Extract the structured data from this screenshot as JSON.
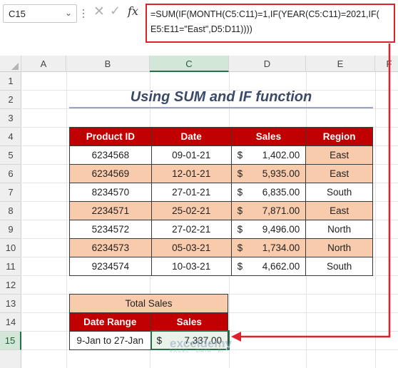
{
  "formula_bar": {
    "name_box": "C15",
    "fx_label": "fx",
    "formula_line1": "=SUM(IF(MONTH(C5:C11)=1,IF(YEAR(C5:C11)=2021,IF(",
    "formula_line2": "E5:E11=\"East\",D5:D11))))"
  },
  "columns": [
    "A",
    "B",
    "C",
    "D",
    "E",
    "F"
  ],
  "rows": [
    "1",
    "2",
    "3",
    "4",
    "5",
    "6",
    "7",
    "8",
    "9",
    "10",
    "11",
    "12",
    "13",
    "14",
    "15"
  ],
  "selected_column": "C",
  "selected_row": "15",
  "title": "Using SUM and IF function",
  "table": {
    "headers": [
      "Product ID",
      "Date",
      "Sales",
      "Region"
    ],
    "rows": [
      {
        "pid": "6234568",
        "date": "09-01-21",
        "cur": "$",
        "amount": "1,402.00",
        "region": "East"
      },
      {
        "pid": "6234569",
        "date": "12-01-21",
        "cur": "$",
        "amount": "5,935.00",
        "region": "East"
      },
      {
        "pid": "8234570",
        "date": "27-01-21",
        "cur": "$",
        "amount": "6,835.00",
        "region": "South"
      },
      {
        "pid": "2234571",
        "date": "25-02-21",
        "cur": "$",
        "amount": "7,871.00",
        "region": "East"
      },
      {
        "pid": "5234572",
        "date": "27-02-21",
        "cur": "$",
        "amount": "9,496.00",
        "region": "North"
      },
      {
        "pid": "6234573",
        "date": "05-03-21",
        "cur": "$",
        "amount": "1,734.00",
        "region": "North"
      },
      {
        "pid": "9234574",
        "date": "10-03-21",
        "cur": "$",
        "amount": "4,662.00",
        "region": "South"
      }
    ]
  },
  "summary": {
    "title": "Total Sales",
    "col1_header": "Date Range",
    "col2_header": "Sales",
    "range": "9-Jan to 27-Jan",
    "cur": "$",
    "amount": "7,337.00"
  },
  "watermark": {
    "main": "exceldemy",
    "sub": "EXCEL · DATA · BI"
  },
  "colors": {
    "header_red": "#c00000",
    "shade_peach": "#f8cbad",
    "title_blue": "#3b4a6b",
    "excel_green": "#217346",
    "annotation_red": "#e0202a"
  },
  "icons": [
    "chevron-down-icon",
    "cancel-icon",
    "enter-check-icon",
    "fx-icon"
  ]
}
